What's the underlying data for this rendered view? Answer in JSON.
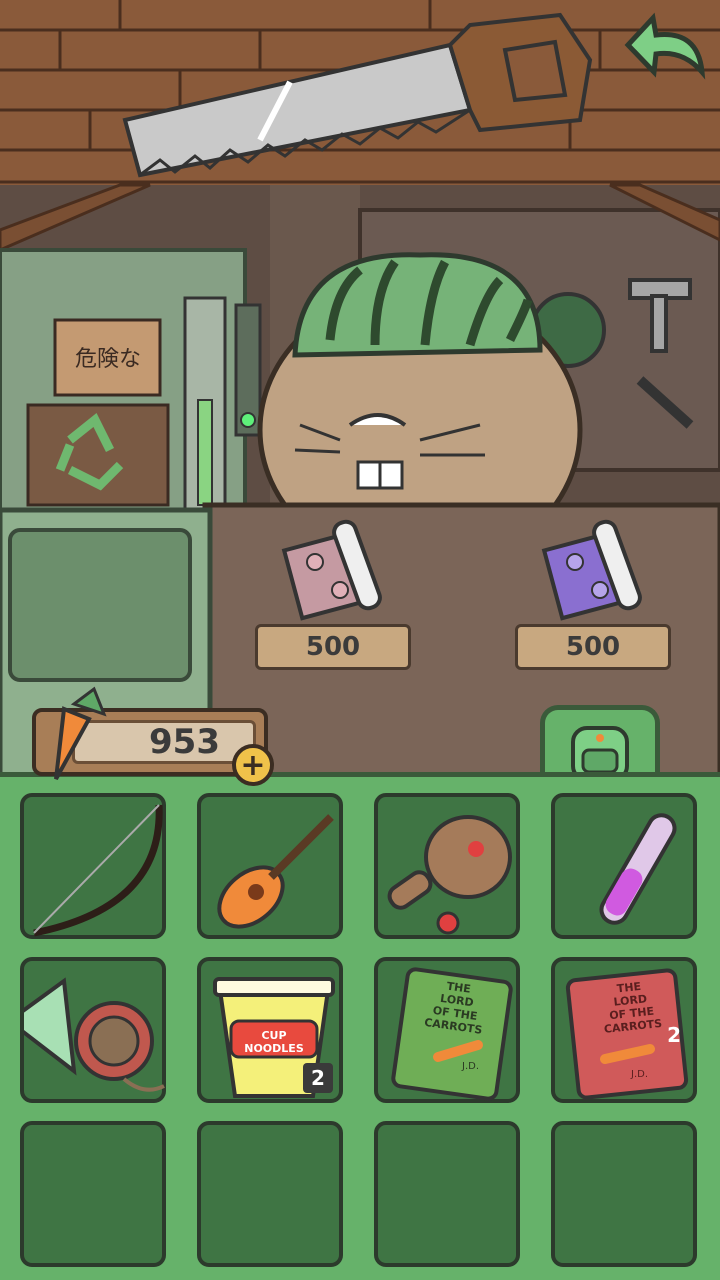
{
  "shop": {
    "items": [
      {
        "name": "sakura-cloth-pink",
        "price": "500"
      },
      {
        "name": "sakura-cloth-purple",
        "price": "500"
      }
    ]
  },
  "wall_sign": {
    "text": "危険な"
  },
  "currency": {
    "carrots": "953",
    "add_label": "+"
  },
  "inventory": {
    "slots": [
      {
        "item": "bow-icon",
        "count": ""
      },
      {
        "item": "carrot-guitar-icon",
        "count": ""
      },
      {
        "item": "wooden-paddle-ball-icon",
        "count": ""
      },
      {
        "item": "potion-vial-icon",
        "count": ""
      },
      {
        "item": "yarn-hat-icon",
        "count": ""
      },
      {
        "item": "cup-noodles-icon",
        "count": "2"
      },
      {
        "item": "lord-of-the-carrots-green-book-icon",
        "count": ""
      },
      {
        "item": "lord-of-the-carrots-red-book-icon",
        "count": "2"
      },
      {
        "item": "empty",
        "count": ""
      },
      {
        "item": "empty",
        "count": ""
      },
      {
        "item": "empty",
        "count": ""
      },
      {
        "item": "empty",
        "count": ""
      }
    ]
  },
  "labels": {
    "noodle_cup": "CUP NOODLES",
    "book_title_line1": "THE",
    "book_title_line2": "LORD",
    "book_title_line3": "OF THE",
    "book_title_line4": "CARROTS",
    "book_author": "J.D."
  },
  "colors": {
    "inventory_bg": "#66b26a",
    "slot_bg": "#3f7544",
    "accent_carrot": "#f08a3a"
  }
}
